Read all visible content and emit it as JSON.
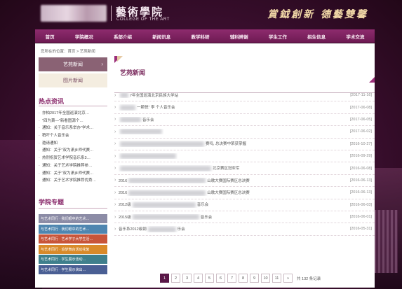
{
  "header": {
    "logo_cn": "藝術學院",
    "logo_en": "COLLEGE OF THE ART",
    "slogan": "賞鉞創新 德藝雙馨"
  },
  "nav": {
    "items": [
      "首页",
      "学院概况",
      "系部介绍",
      "新闻讯息",
      "教学科研",
      "辅科辨谢",
      "学生工作",
      "招生信息",
      "学术交流"
    ]
  },
  "breadcrumb": "您所在的位置：首页 > 艺苑新闻",
  "sidebar": {
    "active_label": "艺苑新闻",
    "active_arrow": "›",
    "other_label": "图片新闻",
    "hot_title": "热点资讯",
    "hot_items": [
      "亦柏2017年全国巡演北京…",
      "\"四为萧—\"新看图源个…",
      "通知：关于音乐系举办\"学术…",
      "稍吓个人音乐会",
      "邀请通知",
      "通知：关于\"双为潇乡师代赛…",
      "热烈祝贺艺术学院音乐系3…",
      "通知：关于艺术学院推荐参…",
      "通知：关于\"双为潇乡师代赛…",
      "通知：关于艺术学院推荐优秀…"
    ],
    "topic_title": "学院专题",
    "topics": [
      {
        "label": "与艺术同行 · 我们眼中的艺术…",
        "color": "#8c8ca6"
      },
      {
        "label": "与艺术同行 · 我们眼中的艺术…",
        "color": "#4f86b0"
      },
      {
        "label": "与艺术同行 · 艺术学子大学生活…",
        "color": "#c8553a"
      },
      {
        "label": "与艺术同行 · 追梦舞台活动花絮",
        "color": "#d98a2a"
      },
      {
        "label": "与艺术同行 · 学生展示活动…",
        "color": "#3f7f8c"
      },
      {
        "label": "与艺术同行 · 学生展示演出…",
        "color": "#4a5f94"
      }
    ]
  },
  "news": {
    "section_title": "艺苑新闻",
    "items": [
      {
        "pre": "",
        "text": "7年全国巡演北京民族大学站",
        "date": "[2017-11-16]"
      },
      {
        "pre": "",
        "text": "一颗悦\"  李      个人音乐会",
        "date": "[2017-06-08]"
      },
      {
        "pre": "",
        "text": "音乐会",
        "date": "[2017-06-05]"
      },
      {
        "pre": "",
        "text": "",
        "date": "[2017-06-02]"
      },
      {
        "pre": "",
        "text": "赛吗, 总决赛中荣获掌握",
        "date": "[2016-10-27]"
      },
      {
        "pre": "",
        "text": "",
        "date": "[2016-09-29]"
      },
      {
        "pre": "",
        "text": "北京赛区冠亚军",
        "date": "[2016-06-08]"
      },
      {
        "pre": "2016",
        "text": "山歌大赛国际赛区总决赛",
        "date": "[2016-06-13]"
      },
      {
        "pre": "2016",
        "text": "山歌大赛国际赛区总决赛",
        "date": "[2016-06-13]"
      },
      {
        "pre": "2012级",
        "text": "音乐会",
        "date": "[2016-06-03]"
      },
      {
        "pre": "2015级",
        "text": "音乐会",
        "date": "[2016-06-01]"
      },
      {
        "pre": "音乐系2012级钢",
        "text": "乐会",
        "date": "[2016-05-31]"
      }
    ]
  },
  "pagination": {
    "pages": [
      "1",
      "2",
      "3",
      "4",
      "5",
      "6",
      "7",
      "8",
      "9",
      "10",
      "11"
    ],
    "next": "»",
    "current": "1",
    "total_text": "共 132 条记录"
  }
}
